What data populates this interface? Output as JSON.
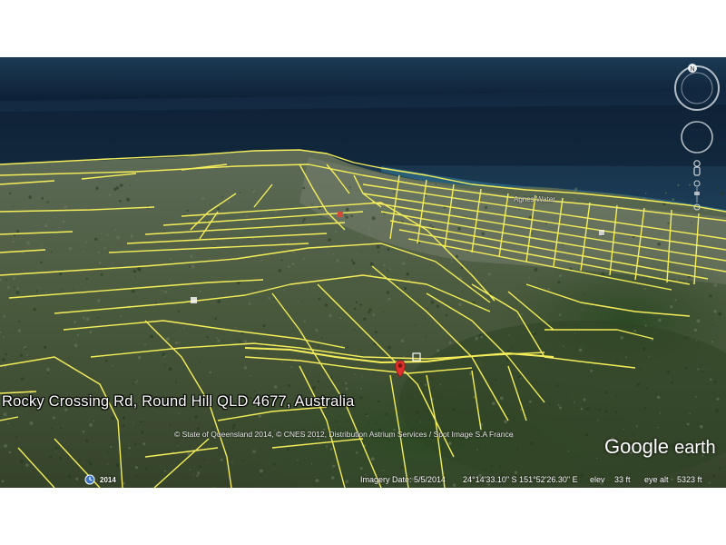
{
  "location": {
    "label": "Rocky Crossing Rd, Round Hill QLD 4677, Australia",
    "town_label": "Agnes Water"
  },
  "attribution": {
    "copyright": "© State of Queensland 2014, © CNES 2012, Distribution Astrium Services / Spot Image S.A France",
    "logo_google": "Google",
    "logo_earth": "earth"
  },
  "status_bar": {
    "historical_year": "2014",
    "imagery_date": "Imagery Date: 5/5/2014",
    "coordinates": "24°14'33.10\" S  151°52'26.30\" E",
    "elev_label": "elev",
    "elev_value": "33 ft",
    "eye_alt_label": "eye alt",
    "eye_alt_value": "5323 ft"
  },
  "navigation": {
    "north_label": "N"
  },
  "colors": {
    "parcel_lines": "#f5ee5a",
    "placemark": "#e0302b",
    "ocean": "#0f2540",
    "vegetation": "#3b4a2e"
  },
  "icons": [
    "compass-ring-icon",
    "look-joystick-icon",
    "pegman-icon",
    "zoom-slider-icon",
    "placemark-pin-icon",
    "historical-imagery-icon"
  ]
}
